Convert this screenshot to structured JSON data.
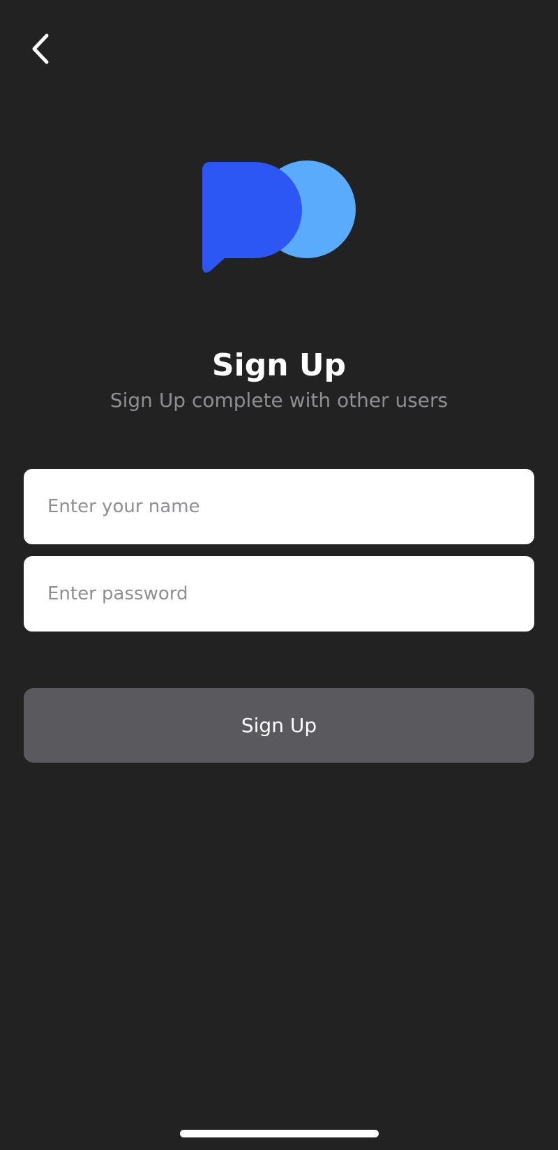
{
  "header": {
    "back_icon": "chevron-left-icon"
  },
  "logo": {
    "icon": "chat-bubble-logo-icon",
    "primary_color": "#2d57f5",
    "secondary_color": "#5aabfb"
  },
  "title": "Sign Up",
  "subtitle": "Sign Up complete with other users",
  "form": {
    "name_placeholder": "Enter your name",
    "password_placeholder": "Enter password",
    "submit_label": "Sign Up",
    "submit_color": "#5a595e"
  },
  "colors": {
    "background": "#222223",
    "subtitle": "#8e8e93",
    "field_background": "#ffffff"
  }
}
